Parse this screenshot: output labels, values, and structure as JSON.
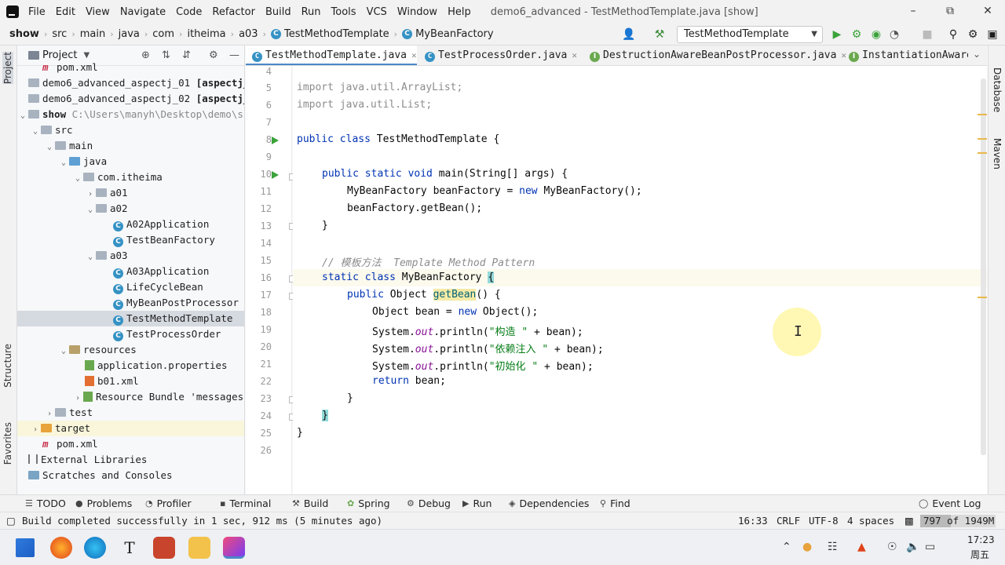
{
  "menu": {
    "items": [
      "File",
      "Edit",
      "View",
      "Navigate",
      "Code",
      "Refactor",
      "Build",
      "Run",
      "Tools",
      "VCS",
      "Window",
      "Help"
    ],
    "window_title": "demo6_advanced - TestMethodTemplate.java [show]"
  },
  "breadcrumb": [
    "show",
    "src",
    "main",
    "java",
    "com",
    "itheima",
    "a03",
    "TestMethodTemplate",
    "MyBeanFactory"
  ],
  "run_config": "TestMethodTemplate",
  "project_panel": {
    "title": "Project",
    "tree": [
      {
        "label": "pom.xml",
        "indent": 1
      },
      {
        "label": "demo6_advanced_aspectj_01",
        "module": "[aspectj_0"
      },
      {
        "label": "demo6_advanced_aspectj_02",
        "module": "[aspectj_0"
      },
      {
        "label": "show",
        "path": "C:\\Users\\manyh\\Desktop\\demo\\sh"
      },
      {
        "label": "src"
      },
      {
        "label": "main"
      },
      {
        "label": "java"
      },
      {
        "label": "com.itheima"
      },
      {
        "label": "a01"
      },
      {
        "label": "a02"
      },
      {
        "label": "A02Application"
      },
      {
        "label": "TestBeanFactory"
      },
      {
        "label": "a03"
      },
      {
        "label": "A03Application"
      },
      {
        "label": "LifeCycleBean"
      },
      {
        "label": "MyBeanPostProcessor"
      },
      {
        "label": "TestMethodTemplate"
      },
      {
        "label": "TestProcessOrder"
      },
      {
        "label": "resources"
      },
      {
        "label": "application.properties"
      },
      {
        "label": "b01.xml"
      },
      {
        "label": "Resource Bundle 'messages"
      },
      {
        "label": "test"
      },
      {
        "label": "target"
      },
      {
        "label": "pom.xml"
      },
      {
        "label": "External Libraries"
      },
      {
        "label": "Scratches and Consoles"
      }
    ]
  },
  "left_stripe": [
    "Project",
    "Structure",
    "Favorites"
  ],
  "right_stripe": [
    "Database",
    "Maven"
  ],
  "tabs": [
    "TestMethodTemplate.java",
    "TestProcessOrder.java",
    "DestructionAwareBeanPostProcessor.java",
    "InstantiationAware"
  ],
  "inspection": {
    "warnings": "4"
  },
  "editor": {
    "line_numbers": [
      "4",
      "5",
      "6",
      "7",
      "8",
      "9",
      "10",
      "11",
      "12",
      "13",
      "14",
      "15",
      "16",
      "17",
      "18",
      "19",
      "20",
      "21",
      "22",
      "23",
      "24",
      "25",
      "26"
    ],
    "lines": {
      "l5": "import java.util.ArrayList;",
      "l6": "import java.util.List;",
      "l8_kw": "public class",
      "l8_rest": " TestMethodTemplate {",
      "l10_kw": "public static void",
      "l10_rest": " main(String[] args) {",
      "l11_a": "MyBeanFactory beanFactory = ",
      "l11_kw": "new",
      "l11_b": " MyBeanFactory();",
      "l12": "beanFactory.getBean();",
      "l13": "}",
      "l15": "// 模板方法  Template Method Pattern",
      "l16_kw": "static class",
      "l16_rest": " MyBeanFactory ",
      "l16_brace": "{",
      "l17_kw": "public",
      "l17_a": " Object ",
      "l17_m": "getBean",
      "l17_b": "() {",
      "l18_a": "Object bean = ",
      "l18_kw": "new",
      "l18_b": " Object();",
      "sys": "System.",
      "out": "out",
      "println": ".println(",
      "l19_str": "\"构造 \"",
      "l20_str": "\"依赖注入 \"",
      "l21_str": "\"初始化 \"",
      "plus_bean": " + bean);",
      "l22_kw": "return",
      "l22_rest": " bean;",
      "l23": "}",
      "l24": "}",
      "l25": "}"
    }
  },
  "tool_windows": [
    "TODO",
    "Problems",
    "Profiler",
    "Terminal",
    "Build",
    "Spring",
    "Debug",
    "Run",
    "Dependencies",
    "Find",
    "Event Log"
  ],
  "status": {
    "message": "Build completed successfully in 1 sec, 912 ms (5 minutes ago)",
    "position": "16:33",
    "line_sep": "CRLF",
    "encoding": "UTF-8",
    "indent": "4 spaces",
    "memory": "797 of 1949M",
    "memory_fraction": 0.41
  },
  "taskbar": {
    "time": "17:23",
    "day": "周五"
  },
  "colors": {
    "keyword": "#0033b3",
    "string": "#067d17",
    "comment": "#8c8c8c",
    "accent": "#4a88c7"
  }
}
